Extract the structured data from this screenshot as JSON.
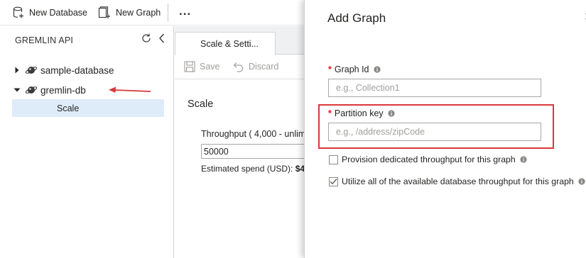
{
  "toolbar": {
    "new_database_label": "New Database",
    "new_graph_label": "New Graph",
    "more_label": "..."
  },
  "left_panel": {
    "title": "GREMLIN API",
    "tree": [
      {
        "label": "sample-database",
        "expanded": false
      },
      {
        "label": "gremlin-db",
        "expanded": true,
        "children": [
          {
            "label": "Scale",
            "selected": true
          }
        ]
      }
    ]
  },
  "middle_panel": {
    "tab_label": "Scale & Setti...",
    "save_label": "Save",
    "discard_label": "Discard",
    "section_heading": "Scale",
    "throughput_label": "Throughput ( 4,000 - unlim",
    "throughput_value": "50000",
    "spend_label": "Estimated spend (USD):",
    "spend_value": "$4."
  },
  "add_graph": {
    "title": "Add Graph",
    "graph_id_label": "Graph Id",
    "graph_id_placeholder": "e.g., Collection1",
    "partition_key_label": "Partition key",
    "partition_key_placeholder": "e.g., /address/zipCode",
    "provision_label": "Provision dedicated throughput for this graph",
    "provision_checked": false,
    "utilize_label": "Utilize all of the available database throughput for this graph",
    "utilize_checked": true,
    "required_mark": "*"
  },
  "colors": {
    "accent": "#0078d4",
    "selection": "#deecf9",
    "annotation_red": "#d9383a",
    "required_red": "#e81123",
    "disabled_text": "#a19f9d"
  },
  "icons": {
    "new_database": "database-plus-icon",
    "new_graph": "graph-plus-icon",
    "refresh": "refresh-icon",
    "collapse": "chevron-left-icon",
    "tree_node": "planet-icon",
    "save": "save-icon",
    "discard": "undo-icon",
    "info": "info-icon"
  }
}
